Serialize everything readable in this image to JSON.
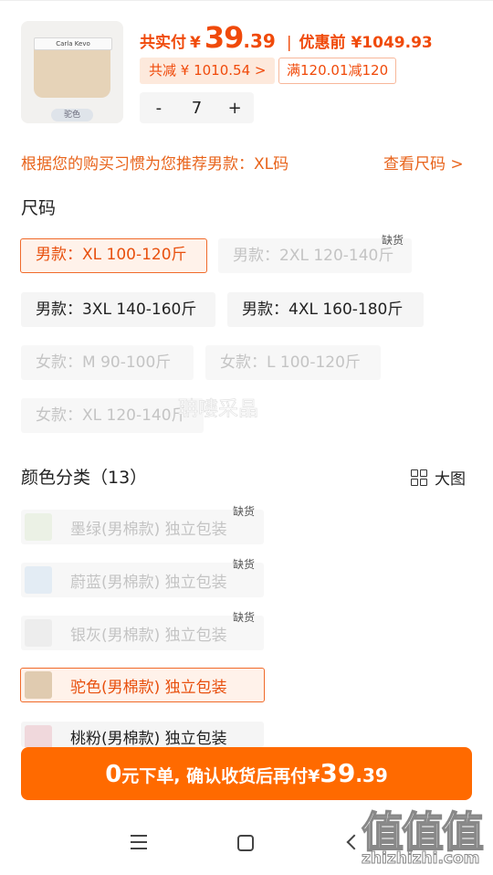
{
  "product": {
    "image_tag": "驼色",
    "band_text": "Carla Kevo",
    "price_label": "共实付",
    "currency": "¥",
    "price_int": "39",
    "price_dec": ".39",
    "separator": "|",
    "orig_label": "优惠前 ¥1049.93",
    "discount_chip": "共减 ¥ 1010.54 >",
    "promo_chip": "满120.01减120",
    "qty_minus": "-",
    "qty_value": "7",
    "qty_plus": "+"
  },
  "recommend": {
    "text": "根据您的购买习惯为您推荐男款：XL码",
    "link": "查看尺码 >"
  },
  "size": {
    "title": "尺码",
    "out_of_stock": "缺货",
    "options": [
      {
        "label": "男款：XL 100-120斤",
        "state": "selected"
      },
      {
        "label": "男款：2XL 120-140斤",
        "state": "disabled"
      },
      {
        "label": "男款：3XL 140-160斤",
        "state": "normal"
      },
      {
        "label": "男款：4XL 160-180斤",
        "state": "normal"
      },
      {
        "label": "女款：M 90-100斤",
        "state": "disabled"
      },
      {
        "label": "女款：L 100-120斤",
        "state": "disabled"
      },
      {
        "label": "女款：XL 120-140斤",
        "state": "disabled"
      }
    ]
  },
  "color": {
    "title": "颜色分类（13）",
    "view_label": "大图",
    "out_of_stock": "缺货",
    "options": [
      {
        "label": "墨绿(男棉款)   独立包装",
        "state": "disabled",
        "swatch": "#e3ecd8"
      },
      {
        "label": "蔚蓝(男棉款)   独立包装",
        "state": "disabled",
        "swatch": "#d6e4f2"
      },
      {
        "label": "银灰(男棉款)   独立包装",
        "state": "disabled",
        "swatch": "#e6e6e6"
      },
      {
        "label": "驼色(男棉款)   独立包装",
        "state": "selected",
        "swatch": "#e0cbb0"
      },
      {
        "label": "桃粉(男棉款)   独立包装",
        "state": "normal",
        "swatch": "#f0d8dc"
      }
    ]
  },
  "order": {
    "zero": "0",
    "text": "元下单, 确认收货后再付",
    "currency": "¥",
    "price_int": "39",
    "price_dec": ".39"
  },
  "watermark": {
    "name": "聃嘍采晶",
    "logo": "值值值",
    "url": "zhizhizhi.com"
  },
  "colors": {
    "accent": "#f04a0a",
    "button": "#ff6a00"
  }
}
